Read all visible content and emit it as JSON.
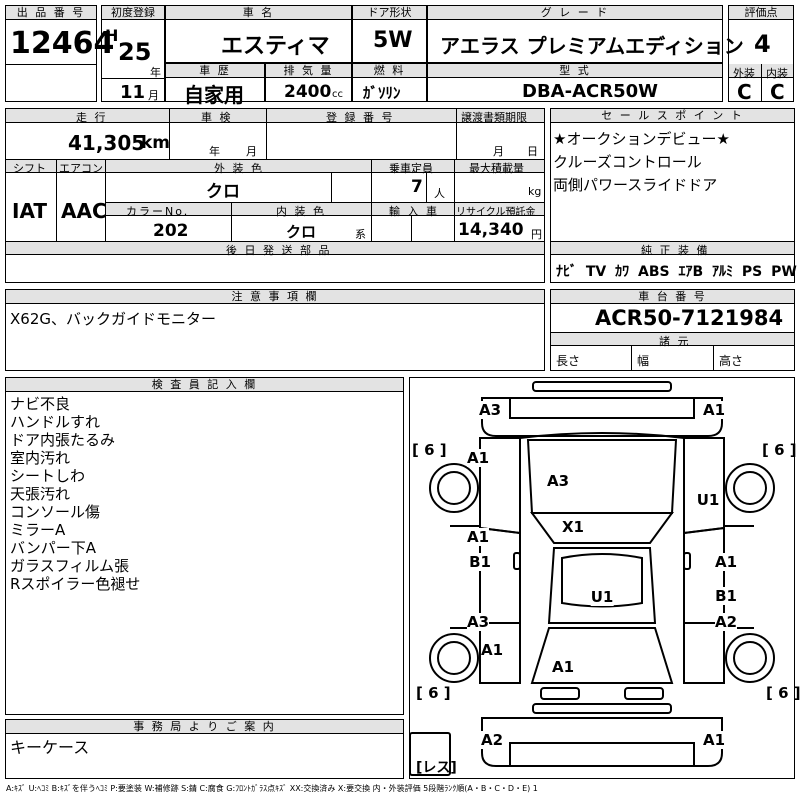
{
  "header": {
    "lot_label": "出 品 番 号",
    "lot_number": "12464",
    "first_reg_label": "初度登録",
    "era": "H",
    "year": "25",
    "year_unit": "年",
    "month": "11",
    "month_unit": "月",
    "car_name_label": "車 名",
    "car_name": "エスティマ",
    "doors_label": "ドア形状",
    "doors": "5W",
    "grade_label": "グ レ ー ド",
    "grade": "アエラス プレミアムエディション",
    "score_label": "評価点",
    "score": "4",
    "history_label": "車 歴",
    "history": "自家用",
    "displacement_label": "排 気 量",
    "displacement": "2400",
    "displacement_unit": "cc",
    "fuel_label": "燃 料",
    "fuel": "ｶﾞｿﾘﾝ",
    "model_label": "型 式",
    "model": "DBA-ACR50W",
    "exterior_label": "外装",
    "exterior": "C",
    "interior_label": "内装",
    "interior": "C"
  },
  "details": {
    "mileage_label": "走 行",
    "mileage": "41,305",
    "mileage_unit": "km",
    "inspection_label": "車 検",
    "inspection_year_unit": "年",
    "inspection_month_unit": "月",
    "reg_no_label": "登 録 番 号",
    "transfer_label": "譲渡書類期限",
    "transfer_month_unit": "月",
    "transfer_day_unit": "日",
    "shift_label": "シフト",
    "shift": "IAT",
    "ac_label": "エアコン",
    "ac": "AAC",
    "ext_color_label": "外 装 色",
    "ext_color": "クロ",
    "capacity_label": "乗車定員",
    "capacity": "7",
    "capacity_unit": "人",
    "load_label": "最大積載量",
    "load_unit": "kg",
    "color_no_label": "カラーNo.",
    "color_no": "202",
    "int_color_label": "内 装 色",
    "int_color": "クロ",
    "int_color_unit": "系",
    "import_label": "輸 入 車",
    "recycle_label": "リサイクル預託金",
    "recycle": "14,340",
    "recycle_unit": "円",
    "later_parts_label": "後 日 発 送 部 品"
  },
  "sales_points": {
    "label": "セ ー ル ス ポ イ ン ト",
    "lines": [
      "★オークションデビュー★",
      "クルーズコントロール",
      "両側パワースライドドア"
    ]
  },
  "equipment": {
    "label": "純 正 装 備",
    "items": [
      "ﾅﾋﾞ",
      "TV",
      "ｶﾜ",
      "ABS",
      "ｴｱB",
      "ｱﾙﾐ",
      "PS",
      "PW"
    ]
  },
  "caution": {
    "label": "注 意 事 項 欄",
    "text": "X62G、バックガイドモニター"
  },
  "chassis": {
    "label": "車 台 番 号",
    "number": "ACR50-7121984",
    "specs_label": "諸 元",
    "length_label": "長さ",
    "width_label": "幅",
    "height_label": "高さ"
  },
  "inspector": {
    "label": "検 査 員 記 入 欄",
    "lines": [
      "ナビ不良",
      "ハンドルすれ",
      "ドア内張たるみ",
      "室内汚れ",
      "シートしわ",
      "天張汚れ",
      "コンソール傷",
      "ミラーA",
      "バンパー下A",
      "ガラスフィルム張",
      "Rスポイラー色褪せ"
    ]
  },
  "office": {
    "label": "事 務 局 よ り ご 案 内",
    "text": "キーケース"
  },
  "diagram": {
    "tire_tl": "[ 6 ]",
    "tire_tr": "[ 6 ]",
    "tire_bl": "[ 6 ]",
    "tire_br": "[ 6 ]",
    "spare": "[レス]",
    "marks": {
      "front_left": "A3",
      "front_right": "A1",
      "fender_fl": "A1",
      "hood": "A3",
      "fender_fr": "U1",
      "windshield": "X1",
      "door_fl_a": "A1",
      "door_fl_b": "B1",
      "door_fr": "A1",
      "roof": "U1",
      "door_rl": "A3",
      "door_rr_b": "B1",
      "door_rr_a": "A2",
      "quarter_rl": "A1",
      "rear_center": "A1",
      "rear_left": "A2",
      "rear_right": "A1"
    }
  },
  "legend": "A:ｷｽﾞ U:ﾍｺﾐ B:ｷｽﾞを伴うﾍｺﾐ P:要塗装 W:補修跡 S:錆 C:腐食 G:ﾌﾛﾝﾄｶﾞﾗｽ点ｷｽﾞ XX:交換済み X:要交換 内・外装評価 5段階ﾗﾝｸ順(A・B・C・D・E) 1"
}
